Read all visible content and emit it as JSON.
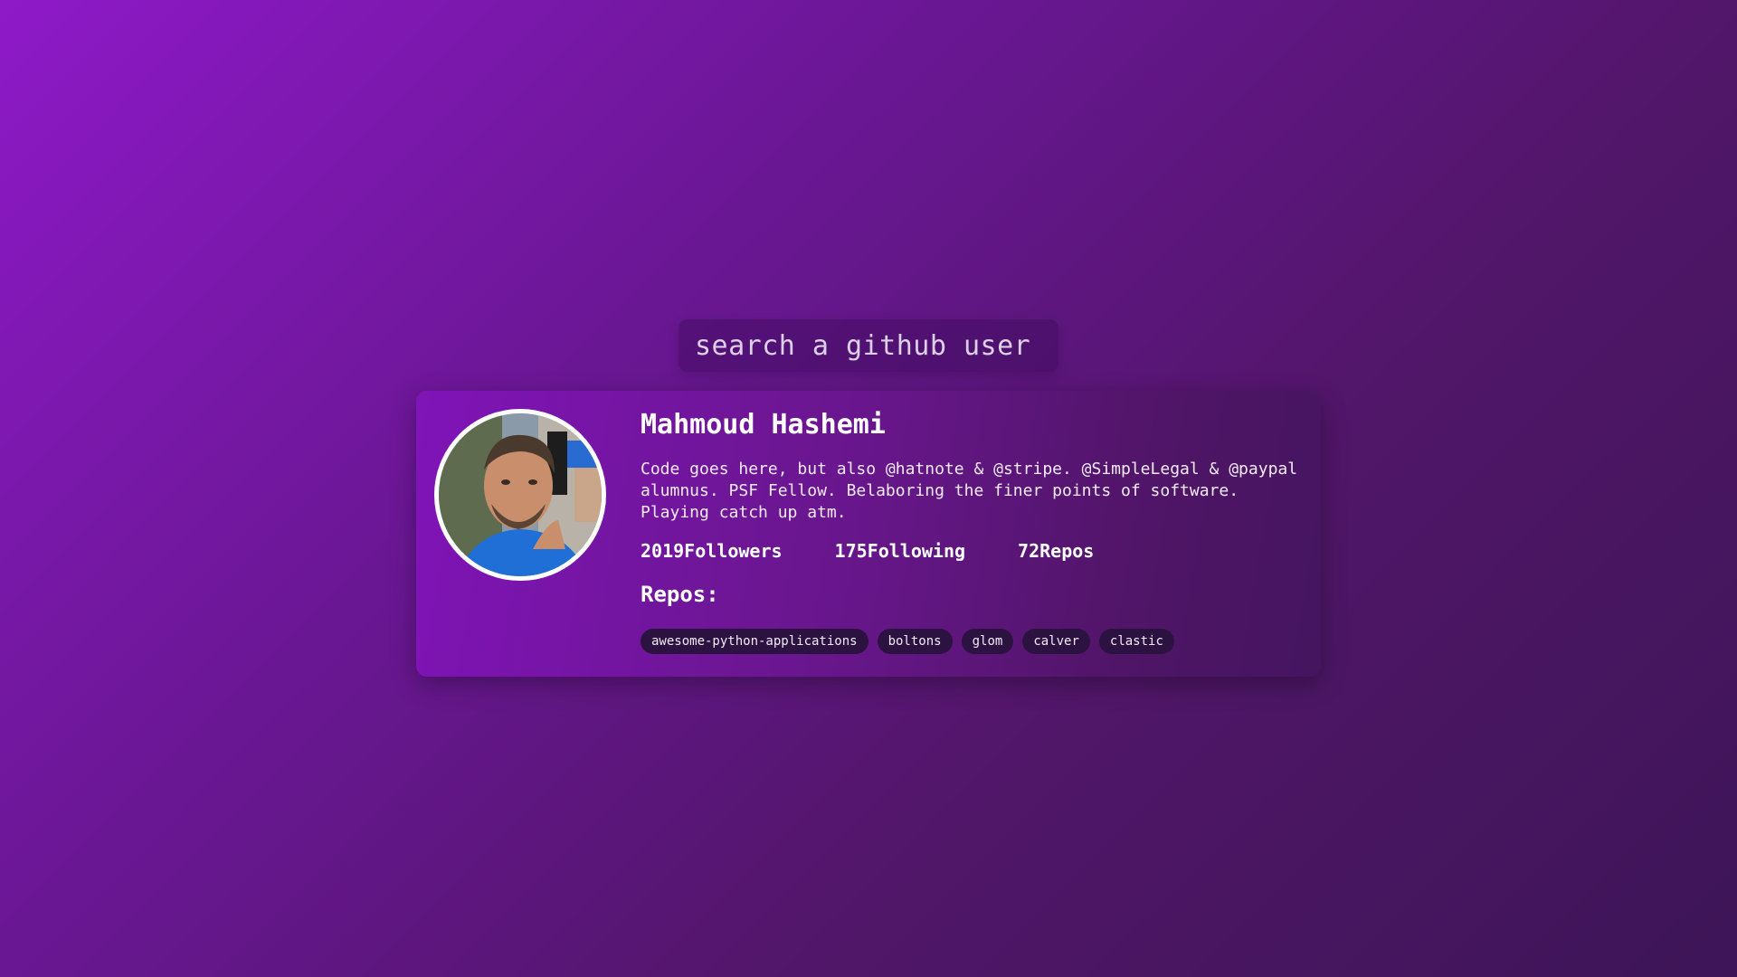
{
  "search": {
    "placeholder": "search a github user"
  },
  "profile": {
    "name": "Mahmoud Hashemi",
    "bio": "Code goes here, but also @hatnote & @stripe. @SimpleLegal & @paypal alumnus. PSF Fellow. Belaboring the finer points of software. Playing catch up atm.",
    "followers": "2019Followers",
    "following": "175Following",
    "repos": "72Repos"
  },
  "repos_section": {
    "title": "Repos:",
    "items": [
      "awesome-python-applications",
      "boltons",
      "glom",
      "calver",
      "clastic"
    ]
  },
  "colors": {
    "bg_start": "#8e19c8",
    "bg_end": "#3d1557",
    "tag_bg": "#2c1240"
  }
}
